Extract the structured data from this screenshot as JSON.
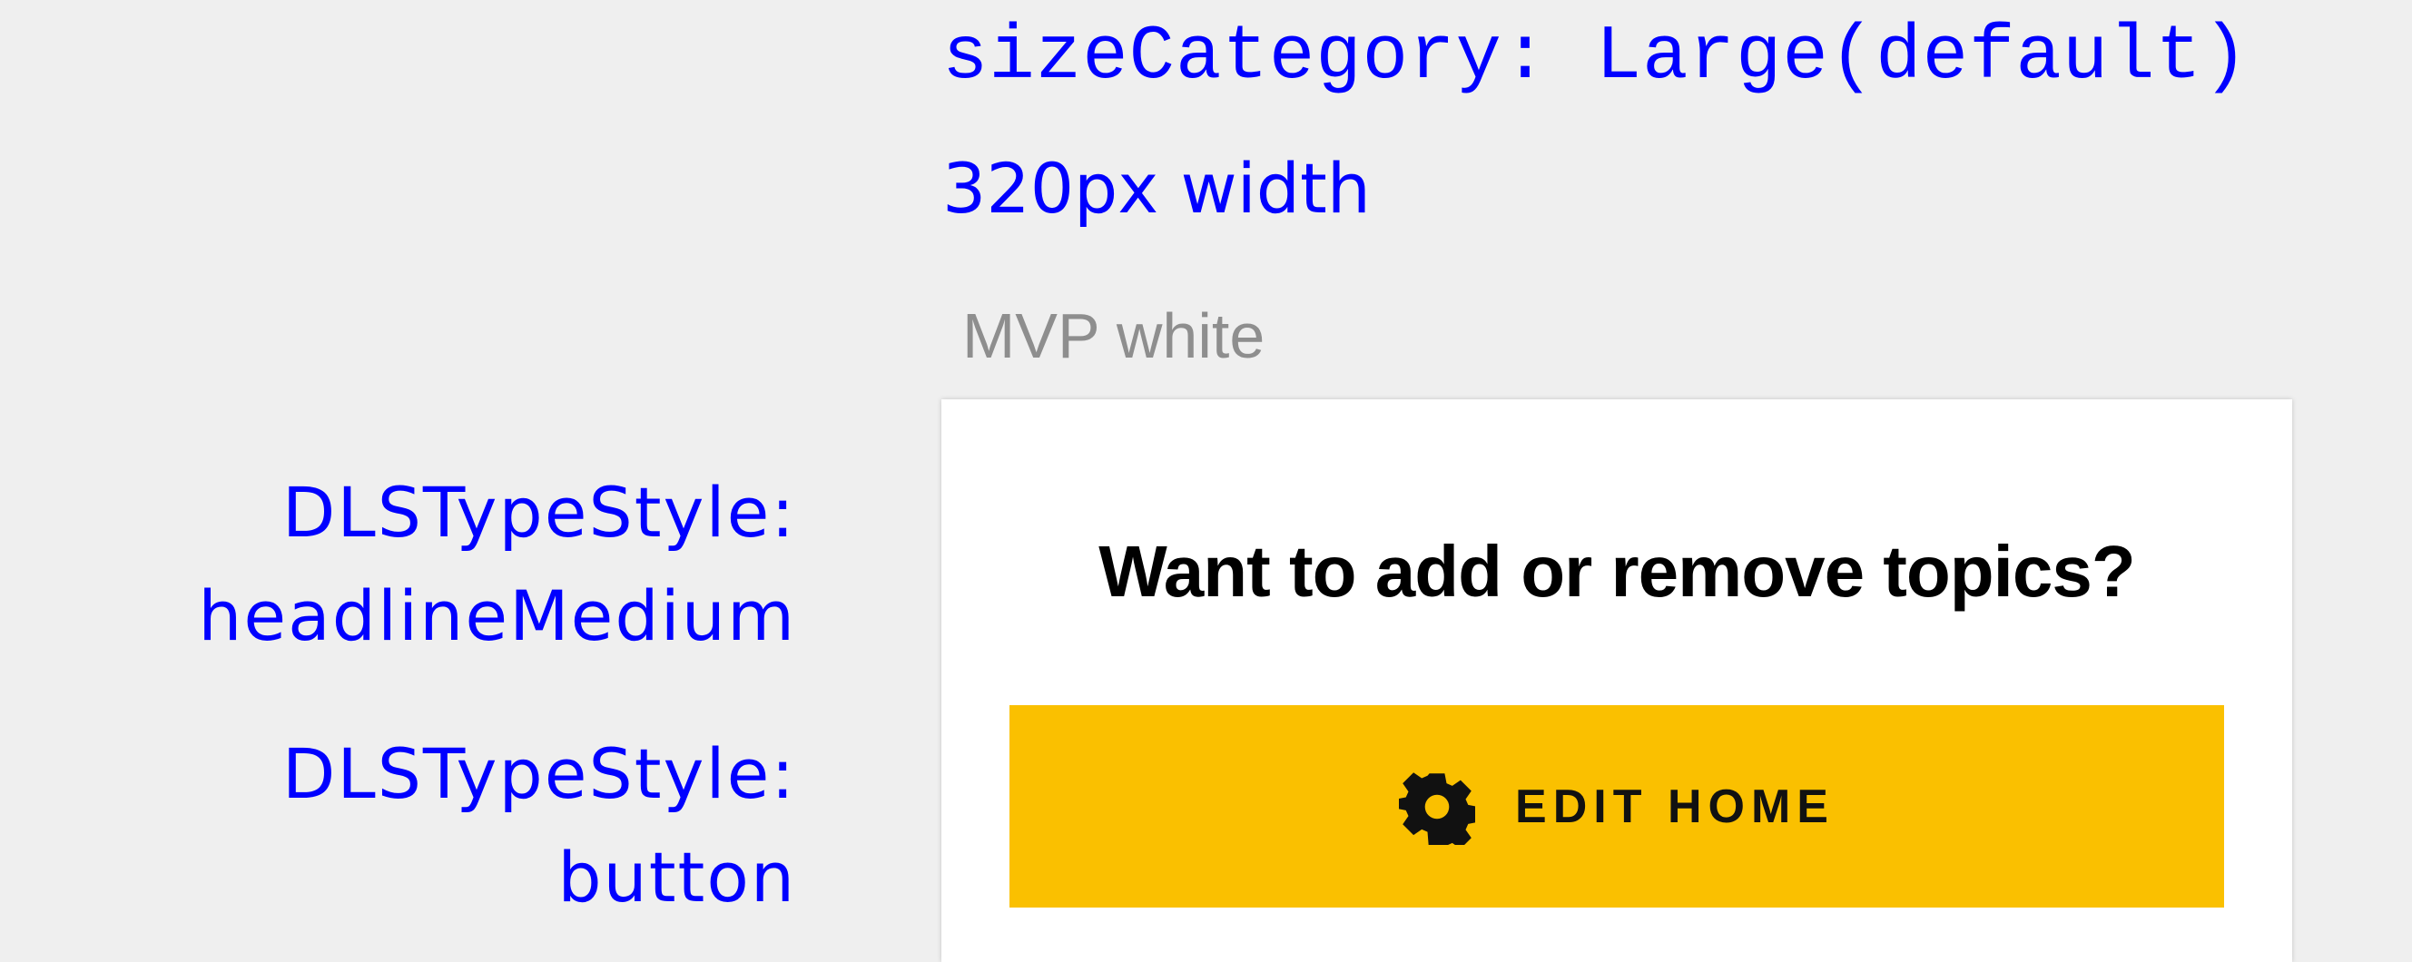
{
  "annotations": {
    "size_category": "sizeCategory: Large(default)",
    "width": "320px width",
    "theme": "MVP white",
    "headline_style": {
      "prefix": "DLSTypeStyle:",
      "name": "headlineMedium"
    },
    "button_style": {
      "prefix": "DLSTypeStyle:",
      "name": "button"
    }
  },
  "card": {
    "title": "Want to add or remove topics?",
    "button": {
      "label": "EDIT HOME",
      "icon": "gear-icon"
    }
  },
  "colors": {
    "annotation": "#0000ff",
    "theme_label": "#8e8e8e",
    "background": "#efefef",
    "card": "#ffffff",
    "button": "#fac000",
    "button_text": "#111111",
    "title_text": "#000000"
  }
}
